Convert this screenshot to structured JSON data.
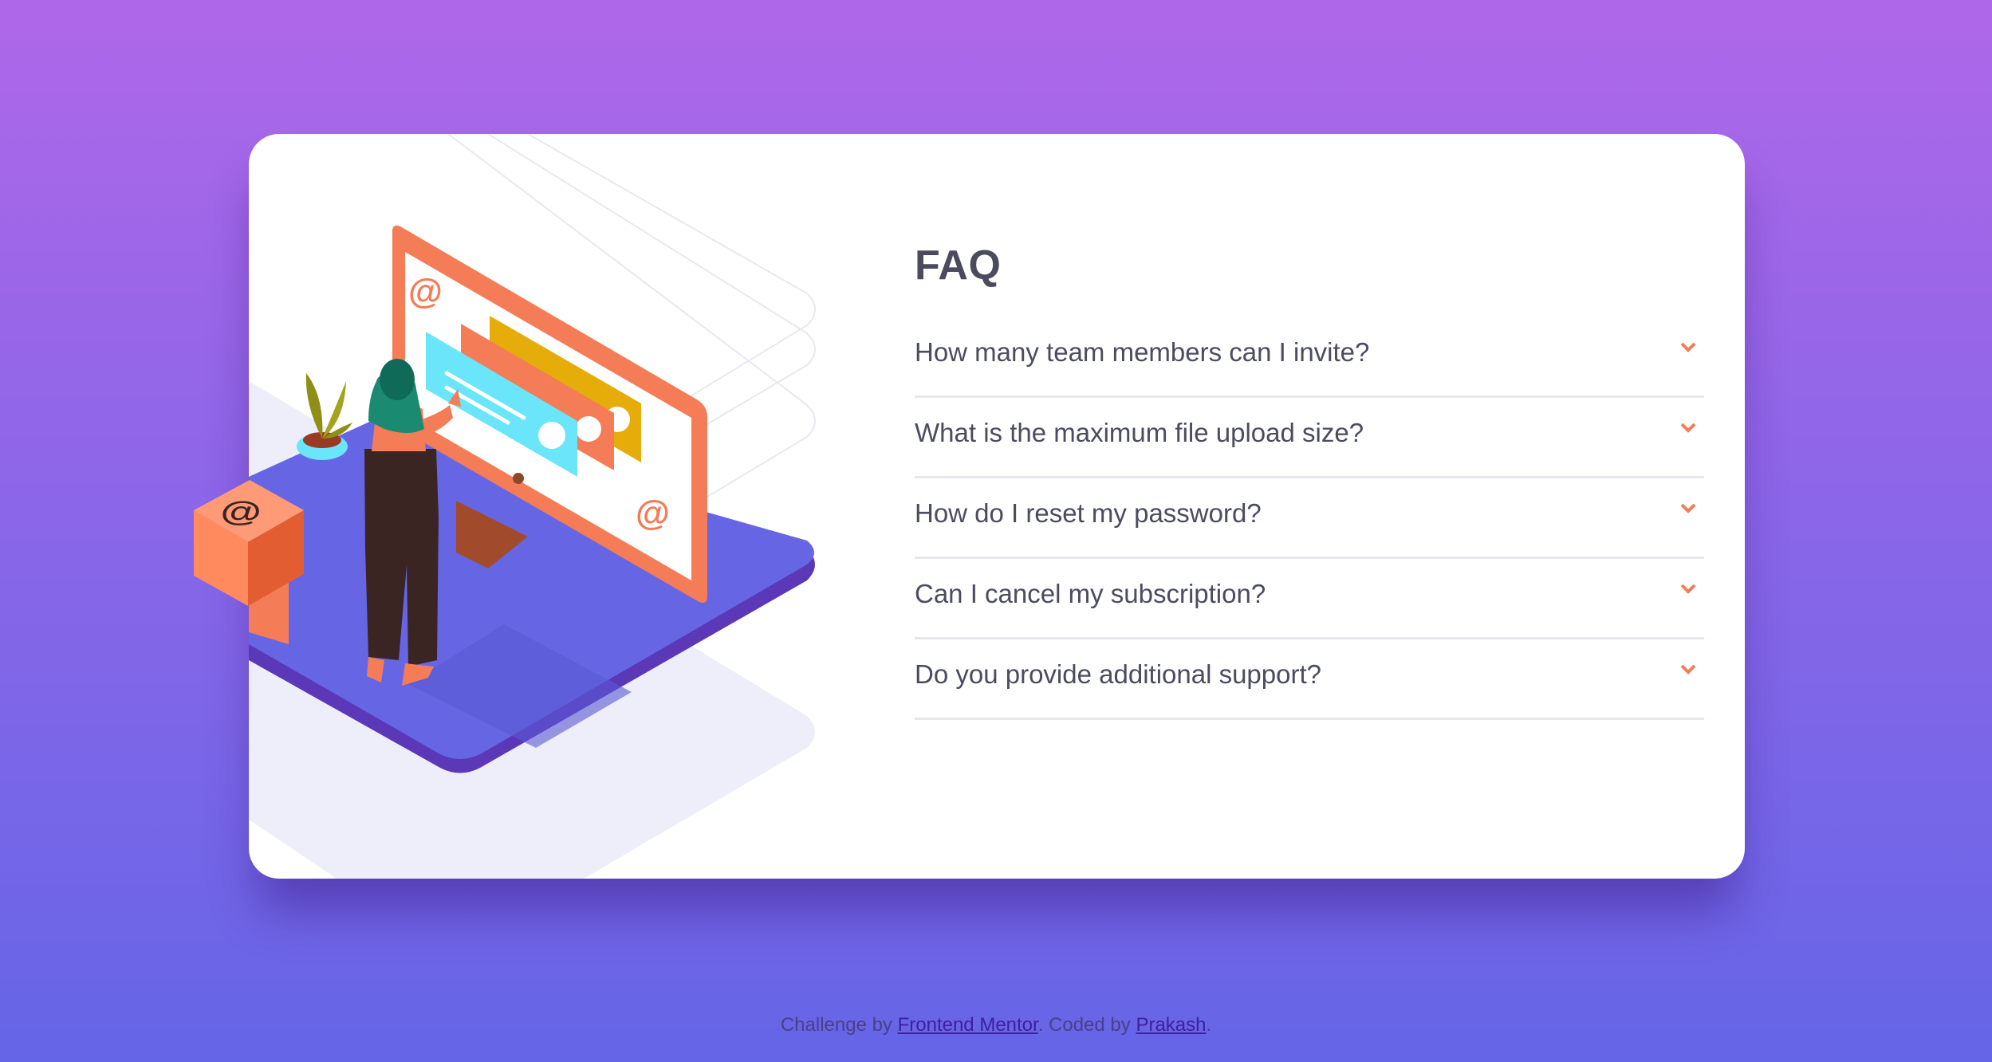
{
  "faq": {
    "title": "FAQ",
    "questions": [
      "How many team members can I invite?",
      "What is the maximum file upload size?",
      "How do I reset my password?",
      "Can I cancel my subscription?",
      "Do you provide additional support?"
    ]
  },
  "illustration": {
    "monitor_symbol_top": "@",
    "monitor_symbol_bottom": "@",
    "box_symbol": "@"
  },
  "attribution": {
    "prefix": "Challenge by ",
    "challenge_link": "Frontend Mentor",
    "middle": ". Coded by ",
    "author_link": "Prakash",
    "suffix": "."
  },
  "colors": {
    "background_top": "#af67e9",
    "background_bottom": "#6565e7",
    "accent": "#f47c57",
    "title": "#4a4b5e",
    "divider": "#e7e7ee"
  },
  "icons": {
    "question_arrow": "chevron-down-icon"
  }
}
